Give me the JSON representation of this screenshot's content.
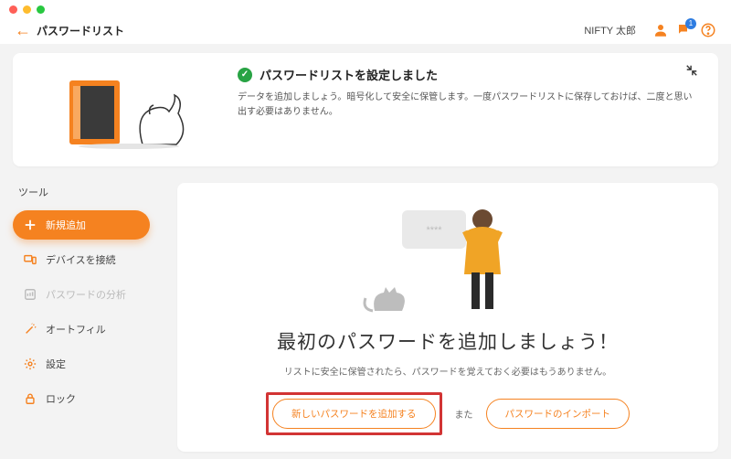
{
  "topbar": {
    "title": "パスワードリスト",
    "user": "NIFTY 太郎",
    "notif_badge": "1"
  },
  "banner": {
    "title": "パスワードリストを設定しました",
    "desc": "データを追加しましょう。暗号化して安全に保管します。一度パスワードリストに保存しておけば、二度と思い出す必要はありません。"
  },
  "sidebar": {
    "title": "ツール",
    "items": {
      "add": {
        "label": "新規追加"
      },
      "connect": {
        "label": "デバイスを接続"
      },
      "analyze": {
        "label": "パスワードの分析"
      },
      "autofill": {
        "label": "オートフィル"
      },
      "settings": {
        "label": "設定"
      },
      "lock": {
        "label": "ロック"
      }
    }
  },
  "content": {
    "card_placeholder": "****",
    "headline": "最初のパスワードを追加しましょう！",
    "subline": "リストに安全に保管されたら、パスワードを覚えておく必要はもうありません。",
    "primary_btn": "新しいパスワードを追加する",
    "or": "また",
    "secondary_btn": "パスワードのインポート"
  }
}
